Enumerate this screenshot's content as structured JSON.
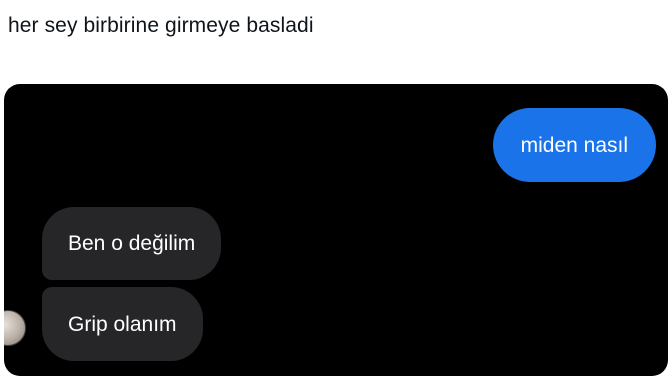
{
  "post": {
    "text": "her sey birbirine girmeye basladi"
  },
  "chat": {
    "messages": [
      {
        "direction": "sent",
        "text": "miden nasıl"
      },
      {
        "direction": "received",
        "text": "Ben o değilim"
      },
      {
        "direction": "received",
        "text": "Grip olanım"
      }
    ],
    "colors": {
      "background": "#000000",
      "sent_bubble": "#1a73e8",
      "received_bubble": "#262628",
      "text": "#ffffff"
    }
  }
}
